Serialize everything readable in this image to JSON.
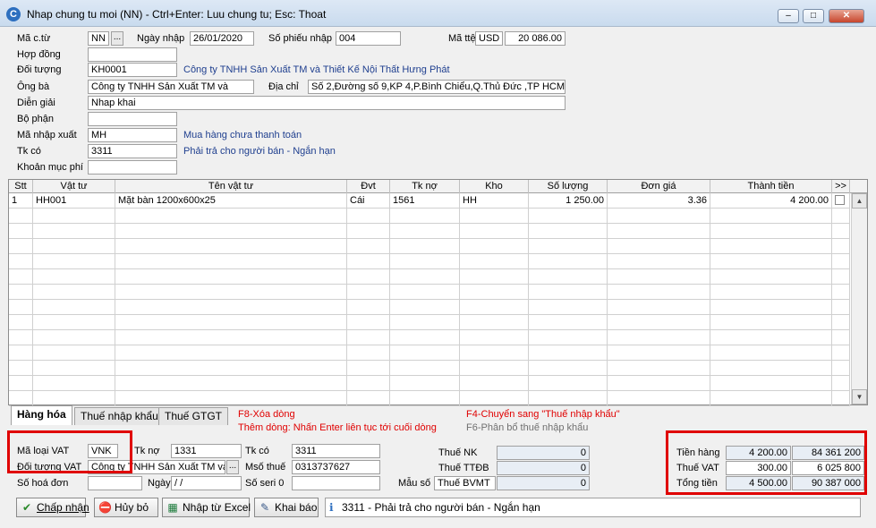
{
  "window": {
    "title": "Nhap chung tu moi (NN) - Ctrl+Enter: Luu chung tu; Esc: Thoat",
    "minimize": "–",
    "maximize": "□",
    "close": "✕"
  },
  "header": {
    "ma_ct_label": "Mã c.từ",
    "ma_ct_value": "NN",
    "dots": "...",
    "ngay_nhap_label": "Ngày nhập",
    "ngay_nhap_value": "26/01/2020",
    "so_phieu_label": "Số phiếu nhập",
    "so_phieu_value": "004",
    "ma_tte_label": "Mã ttệ",
    "ma_tte_value": "USD",
    "ty_gia_value": "20 086.00",
    "hop_dong_label": "Hợp đồng",
    "hop_dong_value": "",
    "doi_tuong_label": "Đối tượng",
    "doi_tuong_value": "KH0001",
    "doi_tuong_name": "Công ty TNHH Sản Xuất TM và Thiết Kế Nội Thất Hưng Phát",
    "ong_ba_label": "Ông bà",
    "ong_ba_value": "Công ty TNHH Sản Xuất TM và",
    "dia_chi_label": "Địa chỉ",
    "dia_chi_value": "Số 2,Đường số 9,KP 4,P.Bình Chiểu,Q.Thủ Đức ,TP HCM",
    "dien_giai_label": "Diễn giải",
    "dien_giai_value": "Nhap khai",
    "bo_phan_label": "Bộ phận",
    "bo_phan_value": "",
    "ma_nhap_xuat_label": "Mã nhập xuất",
    "ma_nhap_xuat_value": "MH",
    "ma_nhap_xuat_name": "Mua hàng chưa thanh toán",
    "tk_co_label": "Tk có",
    "tk_co_value": "3311",
    "tk_co_name": "Phải trả cho người bán - Ngắn hạn",
    "khoan_muc_label": "Khoản mục phí",
    "khoan_muc_value": ""
  },
  "grid": {
    "columns": [
      "Stt",
      "Vật tư",
      "Tên vật tư",
      "Đvt",
      "Tk nợ",
      "Kho",
      "Số lượng",
      "Đơn giá",
      "Thành tiền",
      ">>"
    ],
    "row1": {
      "stt": "1",
      "vat_tu": "HH001",
      "ten": "Mặt bàn 1200x600x25",
      "dvt": "Cái",
      "tk_no": "1561",
      "kho": "HH",
      "so_luong": "1 250.00",
      "don_gia": "3.36",
      "thanh_tien": "4 200.00"
    }
  },
  "tabs": {
    "hang_hoa": "Hàng hóa",
    "thue_nk": "Thuế nhập khẩu",
    "thue_gtgt": "Thuế GTGT"
  },
  "hints": {
    "f8": "F8-Xóa dòng",
    "them_dong": "Thêm dòng: Nhấn Enter liên tục tới cuối dòng",
    "f4": "F4-Chuyển sang \"Thuế nhập khẩu\"",
    "f6": "F6-Phân bổ thuế nhập khẩu"
  },
  "vat": {
    "ma_loai_label": "Mã loại VAT",
    "ma_loai_value": "VNK",
    "tk_no_label": "Tk nợ",
    "tk_no_value": "1331",
    "tk_co_label": "Tk có",
    "tk_co_value": "3311",
    "doi_tuong_label": "Đối tượng VAT",
    "doi_tuong_value": "Công ty TNHH Sản Xuất TM và",
    "mso_thue_label": "Msố thuế",
    "mso_thue_value": "0313737627",
    "so_hoa_don_label": "Số hoá đơn",
    "so_hoa_don_value": "",
    "ngay_label": "Ngày",
    "ngay_value": " /  /",
    "so_seri_label": "Số seri 0",
    "so_seri_value": "",
    "mau_so_label": "Mẫu số",
    "mau_so_value": "Thuế BVMT"
  },
  "taxes": {
    "thue_nk_label": "Thuế NK",
    "thue_nk_value": "0",
    "thue_ttdb_label": "Thuế TTĐB",
    "thue_ttdb_value": "0",
    "thue_bvmt_value": "0"
  },
  "totals": {
    "tien_hang_label": "Tiền hàng",
    "tien_hang_nt": "4 200.00",
    "tien_hang_vnd": "84 361 200",
    "thue_vat_label": "Thuế VAT",
    "thue_vat_nt": "300.00",
    "thue_vat_vnd": "6 025 800",
    "tong_tien_label": "Tổng tiền",
    "tong_tien_nt": "4 500.00",
    "tong_tien_vnd": "90 387 000"
  },
  "buttons": {
    "chap_nhan": "Chấp nhận",
    "huy_bo": "Hủy bỏ",
    "nhap_excel": "Nhập từ Excel",
    "khai_bao": "Khai báo"
  },
  "status": "3311 - Phải trả cho người bán - Ngắn hạn",
  "colors": {
    "highlight": "#e00000",
    "link_text": "#1f3f8f"
  }
}
